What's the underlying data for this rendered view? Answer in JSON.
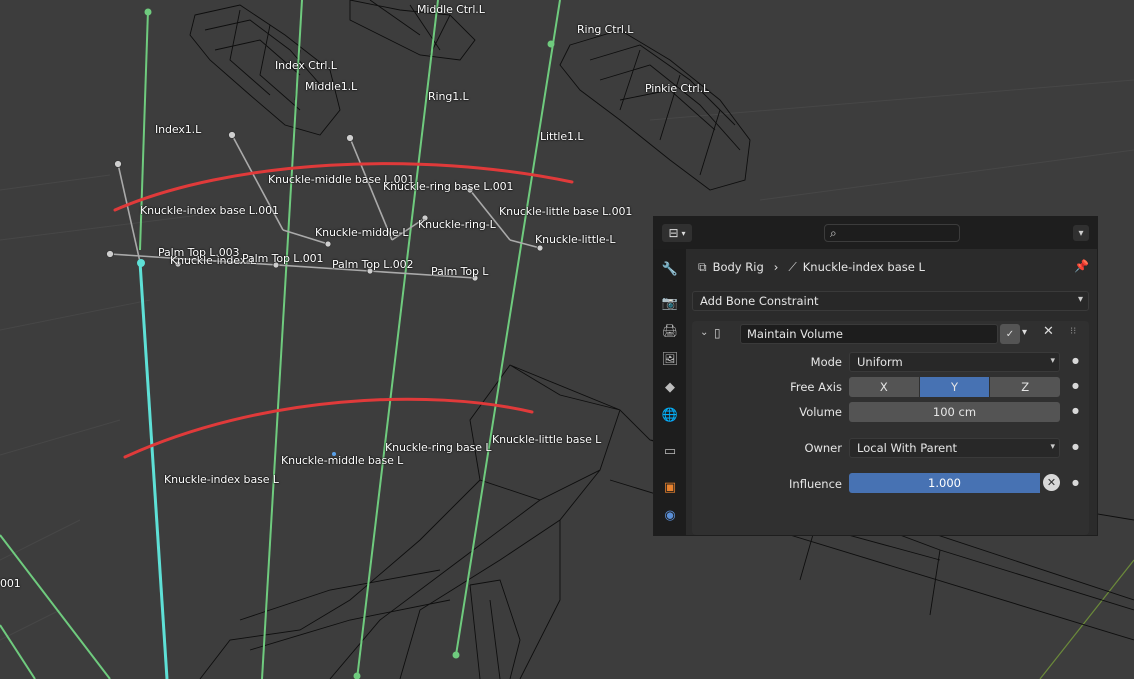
{
  "viewport": {
    "labels": [
      {
        "text": "Middle Ctrl.L"
      },
      {
        "text": "Ring Ctrl.L"
      },
      {
        "text": "Index Ctrl.L"
      },
      {
        "text": "Middle1.L"
      },
      {
        "text": "Pinkie Ctrl.L"
      },
      {
        "text": "Ring1.L"
      },
      {
        "text": "Index1.L"
      },
      {
        "text": "Little1.L"
      },
      {
        "text": "Knuckle-middle base L.001"
      },
      {
        "text": "Knuckle-ring base L.001"
      },
      {
        "text": "Knuckle-index base L.001"
      },
      {
        "text": "Knuckle-little base L.001"
      },
      {
        "text": "Knuckle-ring-L"
      },
      {
        "text": "Knuckle-middle-L"
      },
      {
        "text": "Knuckle-little-L"
      },
      {
        "text": "Palm Top L.003"
      },
      {
        "text": "Knuckle-index-L"
      },
      {
        "text": "Palm Top L.001"
      },
      {
        "text": "Palm Top L.002"
      },
      {
        "text": "Palm Top L"
      },
      {
        "text": "Knuckle-ring base L"
      },
      {
        "text": "Knuckle-little base L"
      },
      {
        "text": "Knuckle-middle base L"
      },
      {
        "text": "Knuckle-index base L"
      },
      {
        "text": "001"
      }
    ],
    "colors": {
      "background": "#3d3d3d",
      "bone": "#6fcb7e",
      "selected_bone": "#5ee0d6",
      "annotation": "#e03a3a",
      "wire": "#0d0d0d"
    }
  },
  "panel": {
    "header": {
      "editor_icon": "properties-editor-icon",
      "search_placeholder": "",
      "search_icon": "⌕"
    },
    "tabs": [
      {
        "name": "tool-tab",
        "glyph": "🔧"
      },
      {
        "name": "render-tab",
        "glyph": "📷"
      },
      {
        "name": "output-tab",
        "glyph": "🖨"
      },
      {
        "name": "view-layer-tab",
        "glyph": "🖼"
      },
      {
        "name": "scene-tab",
        "glyph": "◆"
      },
      {
        "name": "world-tab",
        "glyph": "🌐"
      },
      {
        "name": "collection-tab",
        "glyph": "▭"
      },
      {
        "name": "object-tab",
        "glyph": "▣"
      },
      {
        "name": "bone-constraint-tab",
        "glyph": "◉"
      }
    ],
    "breadcrumb": {
      "object": "Body Rig",
      "separator": "›",
      "bone": "Knuckle-index base L"
    },
    "add_constraint": "Add Bone Constraint",
    "constraint": {
      "name": "Maintain Volume",
      "mode_label": "Mode",
      "mode_value": "Uniform",
      "free_axis_label": "Free Axis",
      "axes": [
        "X",
        "Y",
        "Z"
      ],
      "active_axis": "Y",
      "volume_label": "Volume",
      "volume_value": "100 cm",
      "owner_label": "Owner",
      "owner_value": "Local With Parent",
      "influence_label": "Influence",
      "influence_value": "1.000"
    }
  }
}
